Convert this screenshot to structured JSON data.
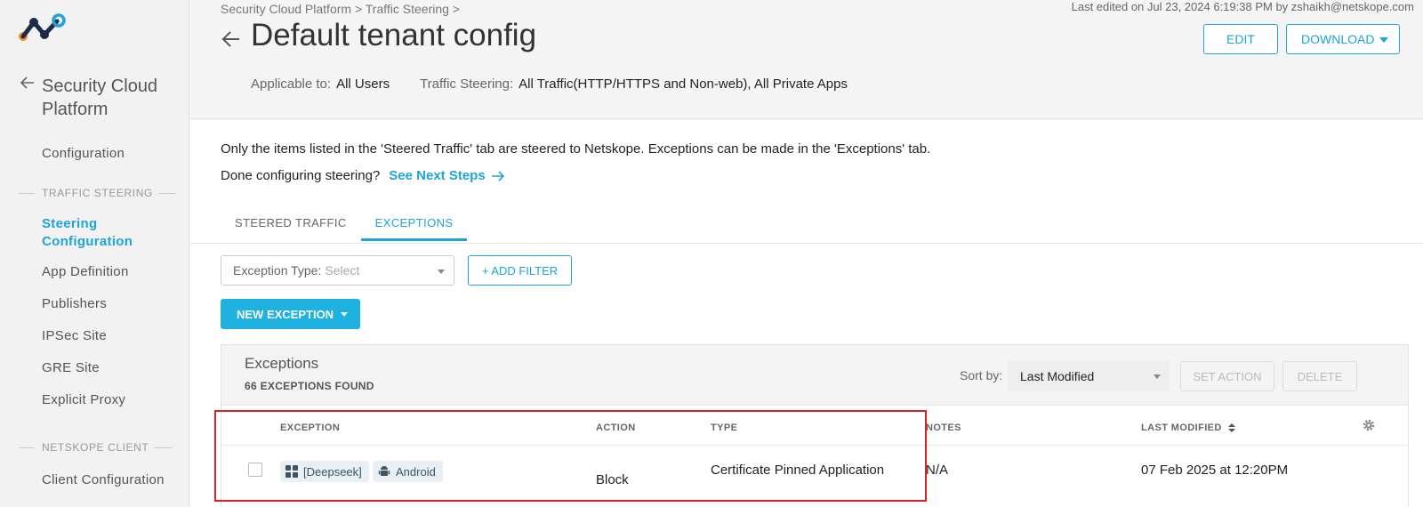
{
  "sidebar": {
    "title": "Security Cloud Platform",
    "items": [
      {
        "label": "Configuration"
      },
      {
        "section": "TRAFFIC STEERING"
      },
      {
        "label": "Steering Configuration"
      },
      {
        "label": "App Definition"
      },
      {
        "label": "Publishers"
      },
      {
        "label": "IPSec Site"
      },
      {
        "label": "GRE Site"
      },
      {
        "label": "Explicit Proxy"
      },
      {
        "section": "NETSKOPE CLIENT"
      },
      {
        "label": "Client Configuration"
      }
    ]
  },
  "header": {
    "breadcrumb": "Security Cloud Platform > Traffic Steering >",
    "last_edited": "Last edited on Jul 23, 2024 6:19:38 PM by zshaikh@netskope.com",
    "title": "Default tenant config",
    "edit_label": "EDIT",
    "download_label": "DOWNLOAD",
    "applicable_label": "Applicable to:",
    "applicable_value": "All Users",
    "steering_label": "Traffic Steering:",
    "steering_value": "All Traffic(HTTP/HTTPS and Non-web), All Private Apps"
  },
  "content": {
    "info_text": "Only the items listed in the 'Steered Traffic' tab are steered to Netskope. Exceptions can be made in the 'Exceptions' tab.",
    "done_text": "Done configuring steering?",
    "see_next_label": "See Next Steps",
    "tabs": [
      {
        "label": "STEERED TRAFFIC",
        "active": false
      },
      {
        "label": "EXCEPTIONS",
        "active": true
      }
    ],
    "filter": {
      "label": "Exception Type:",
      "placeholder": "Select"
    },
    "add_filter_label": "+ ADD FILTER",
    "new_exception_label": "NEW EXCEPTION"
  },
  "panel": {
    "title": "Exceptions",
    "count": "66 EXCEPTIONS FOUND",
    "sort_label": "Sort by:",
    "sort_value": "Last Modified",
    "set_action_label": "SET ACTION",
    "delete_label": "DELETE",
    "columns": [
      "EXCEPTION",
      "ACTION",
      "TYPE",
      "NOTES",
      "LAST MODIFIED"
    ],
    "rows": [
      {
        "app": "[Deepseek]",
        "platform": "Android",
        "action": "Block",
        "type": "Certificate Pinned Application",
        "notes": "N/A",
        "last_modified": "07 Feb 2025 at 12:20PM"
      }
    ]
  },
  "colors": {
    "accent": "#1fa4d6",
    "primary_button": "#1fb2e0",
    "highlight": "#e02020",
    "logo_orange": "#f28c28",
    "logo_navy": "#1e2a4a",
    "logo_blue": "#1fa4d6"
  }
}
